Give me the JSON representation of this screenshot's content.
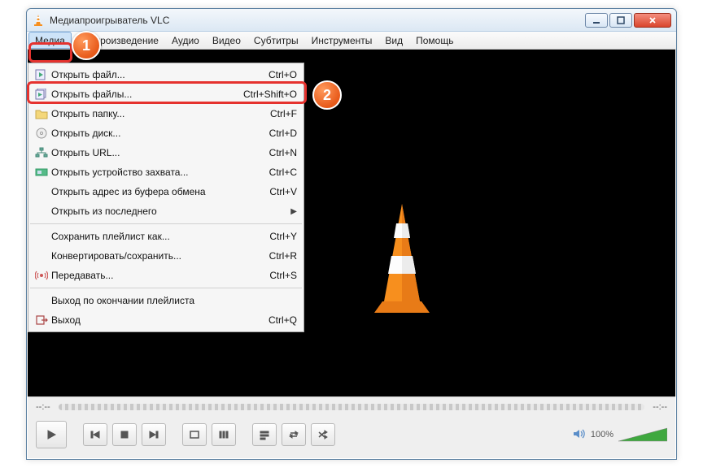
{
  "window": {
    "title": "Медиапроигрыватель VLC"
  },
  "menubar": {
    "items": [
      "Медиа",
      "Воспроизведение",
      "Аудио",
      "Видео",
      "Субтитры",
      "Инструменты",
      "Вид",
      "Помощь"
    ],
    "active_index": 0
  },
  "dropdown": {
    "items": [
      {
        "icon": "file-play",
        "label": "Открыть файл...",
        "shortcut": "Ctrl+O"
      },
      {
        "icon": "files-play",
        "label": "Открыть файлы...",
        "shortcut": "Ctrl+Shift+O",
        "highlighted": true
      },
      {
        "icon": "folder",
        "label": "Открыть папку...",
        "shortcut": "Ctrl+F"
      },
      {
        "icon": "disc",
        "label": "Открыть диск...",
        "shortcut": "Ctrl+D"
      },
      {
        "icon": "network",
        "label": "Открыть URL...",
        "shortcut": "Ctrl+N"
      },
      {
        "icon": "capture",
        "label": "Открыть устройство захвата...",
        "shortcut": "Ctrl+C"
      },
      {
        "icon": "",
        "label": "Открыть адрес из буфера обмена",
        "shortcut": "Ctrl+V"
      },
      {
        "icon": "",
        "label": "Открыть из последнего",
        "submenu": true
      },
      {
        "sep": true
      },
      {
        "icon": "",
        "label": "Сохранить плейлист как...",
        "shortcut": "Ctrl+Y"
      },
      {
        "icon": "",
        "label": "Конвертировать/сохранить...",
        "shortcut": "Ctrl+R"
      },
      {
        "icon": "stream",
        "label": "Передавать...",
        "shortcut": "Ctrl+S"
      },
      {
        "sep": true
      },
      {
        "icon": "",
        "label": "Выход по окончании плейлиста"
      },
      {
        "icon": "quit",
        "label": "Выход",
        "shortcut": "Ctrl+Q"
      }
    ]
  },
  "badges": {
    "one": "1",
    "two": "2"
  },
  "controls": {
    "time_elapsed": "--:--",
    "time_total": "--:--",
    "volume_pct": "100%"
  }
}
